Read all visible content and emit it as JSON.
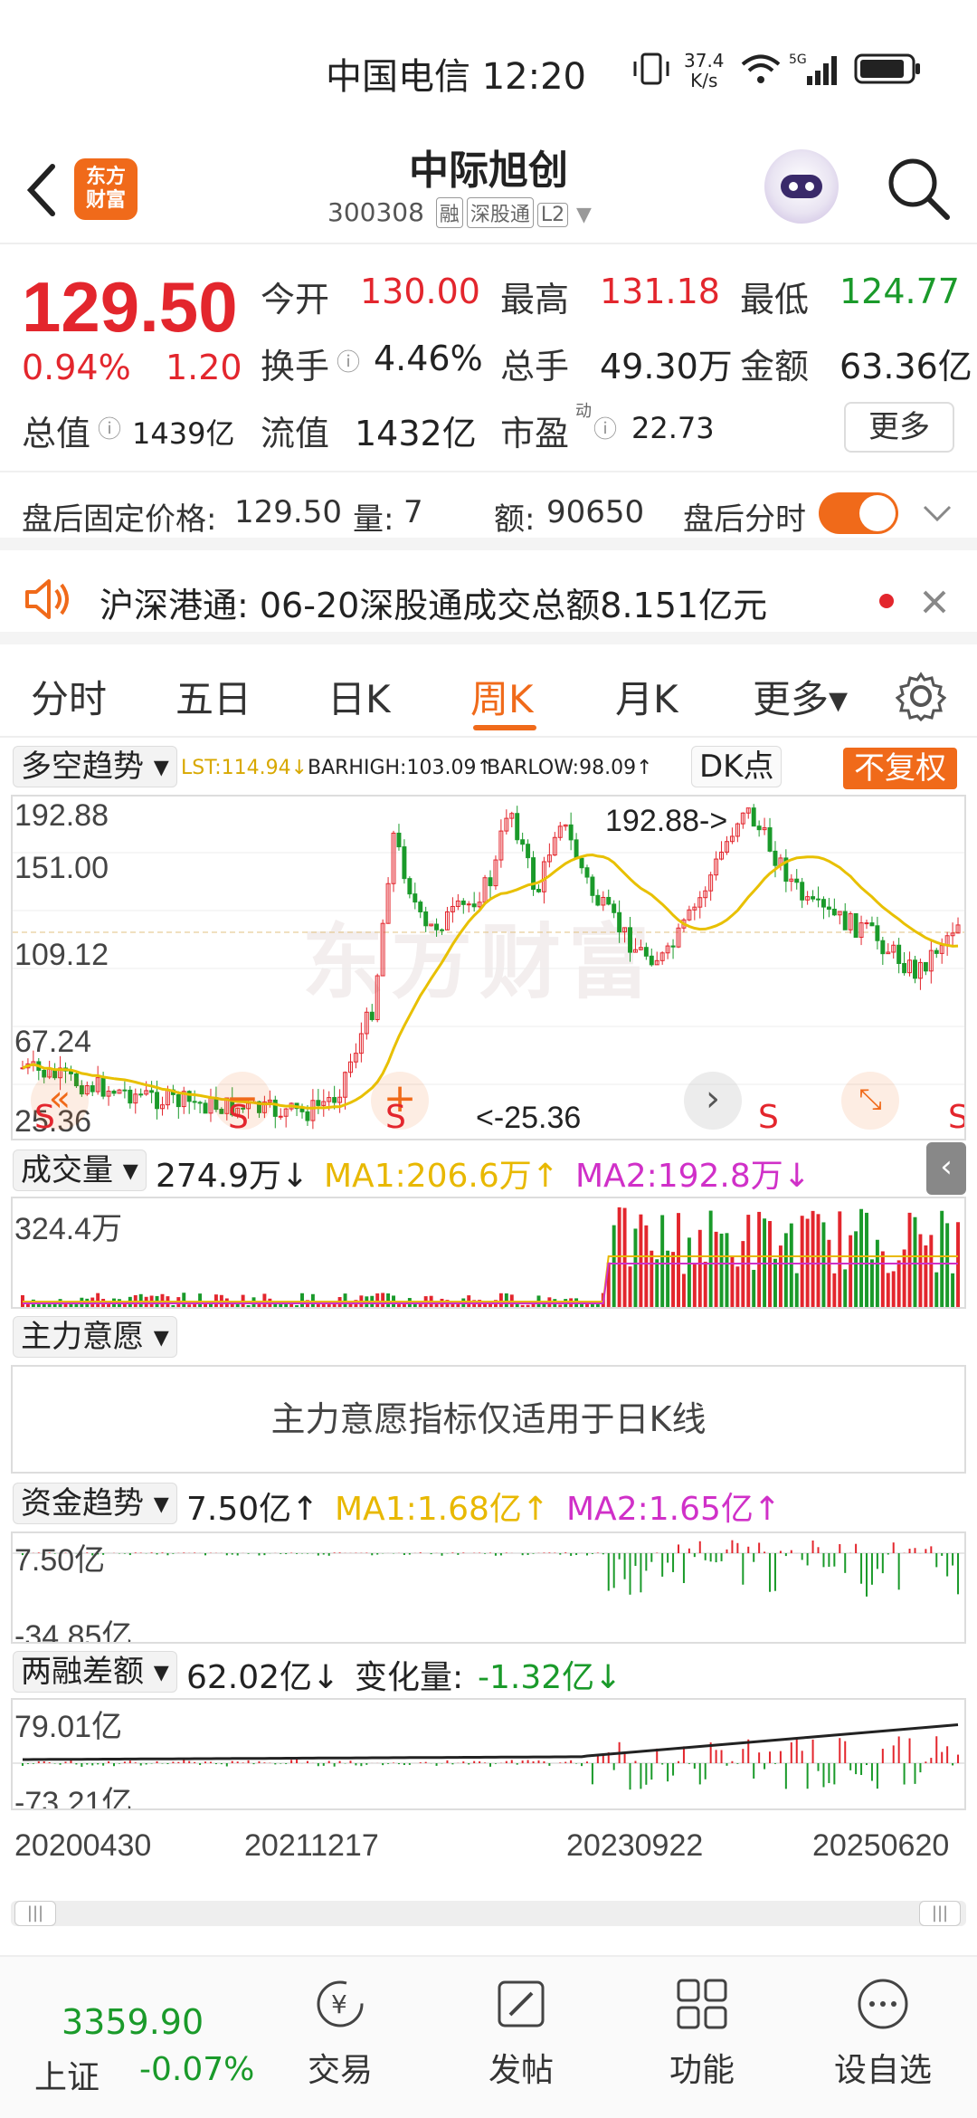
{
  "status_bar": {
    "carrier_time": "中国电信 12:20",
    "speed_value": "37.4",
    "speed_unit": "K/s",
    "network": "5G"
  },
  "header": {
    "app_logo_line1": "东方",
    "app_logo_line2": "财富",
    "stock_name": "中际旭创",
    "stock_code": "300308",
    "tags": [
      "融",
      "深股通",
      "L2"
    ]
  },
  "quote": {
    "price": "129.50",
    "change_pct": "0.94%",
    "change_val": "1.20",
    "open_label": "今开",
    "open": "130.00",
    "high_label": "最高",
    "high": "131.18",
    "low_label": "最低",
    "low": "124.77",
    "turnover_label": "换手",
    "turnover": "4.46%",
    "volume_label": "总手",
    "volume": "49.30万",
    "amount_label": "金额",
    "amount": "63.36亿",
    "total_mv_label": "总值",
    "total_mv": "1439亿",
    "float_mv_label": "流值",
    "float_mv": "1432亿",
    "pe_label": "市盈",
    "pe_sup": "动",
    "pe": "22.73",
    "more_label": "更多"
  },
  "after_hours": {
    "fixed_price_label": "盘后固定价格:",
    "fixed_price": "129.50",
    "qty_label": "量:",
    "qty": "7",
    "amt_label": "额:",
    "amt": "90650",
    "toggle_label": "盘后分时",
    "toggle_on": true
  },
  "ticker": {
    "text": "沪深港通:  06-20深股通成交总额8.151亿元"
  },
  "tabs": [
    "分时",
    "五日",
    "日K",
    "周K",
    "月K",
    "更多▾"
  ],
  "active_tab": "周K",
  "main_chart": {
    "indicator": "多空趋势 ▾",
    "lst": "LST:114.94↓",
    "barhigh": "BARHIGH:103.09↑",
    "barlow": "BARLOW:98.09↑",
    "dk_button": "DK点",
    "adjust_button": "不复权",
    "y_labels": [
      "192.88",
      "151.00",
      "109.12",
      "67.24",
      "25.36"
    ],
    "max_marker": "192.88->",
    "min_marker": "<-25.36",
    "signal_labels": [
      "S",
      "S",
      "S",
      "S",
      "S"
    ],
    "watermark": "东方财富"
  },
  "volume_chart": {
    "indicator": "成交量 ▾",
    "value": "274.9万↓",
    "ma1": "MA1:206.6万↑",
    "ma2": "MA2:192.8万↓",
    "y_label": "324.4万"
  },
  "main_force": {
    "indicator": "主力意愿 ▾",
    "message": "主力意愿指标仅适用于日K线"
  },
  "fund_trend": {
    "indicator": "资金趋势 ▾",
    "value": "7.50亿↑",
    "ma1": "MA1:1.68亿↑",
    "ma2": "MA2:1.65亿↑",
    "y_top": "7.50亿",
    "y_bottom": "-34.85亿"
  },
  "margin_diff": {
    "indicator": "两融差额 ▾",
    "value": "62.02亿↓",
    "change_label": "变化量:",
    "change": "-1.32亿↓",
    "y_top": "79.01亿",
    "y_bottom": "-73.21亿"
  },
  "x_axis_dates": [
    "20200430",
    "20211217",
    "20230922",
    "20250620"
  ],
  "bottom_nav": {
    "index_value": "3359.90",
    "index_name": "上证",
    "index_change": "-0.07%",
    "items": [
      "交易",
      "发帖",
      "功能",
      "设自选"
    ]
  },
  "colors": {
    "up": "#e3262d",
    "down": "#1a9a2a",
    "accent": "#f06a1a",
    "ma1": "#f0c000",
    "ma2": "#d030c8"
  }
}
